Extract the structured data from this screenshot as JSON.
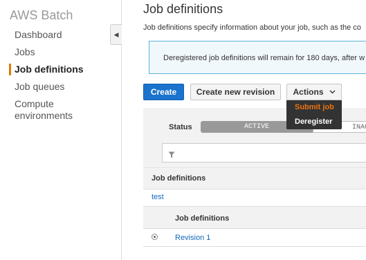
{
  "sidebar": {
    "brand": "AWS Batch",
    "items": [
      {
        "label": "Dashboard"
      },
      {
        "label": "Jobs"
      },
      {
        "label": "Job definitions"
      },
      {
        "label": "Job queues"
      },
      {
        "label": "Compute\nenvironments"
      }
    ],
    "collapse_icon": "caret-left-icon"
  },
  "main": {
    "title": "Job definitions",
    "description": "Job definitions specify information about your job, such as the co",
    "info": "Deregistered job definitions will remain for 180 days, after w",
    "buttons": {
      "create": "Create",
      "create_revision": "Create new revision",
      "actions": "Actions"
    },
    "actions_menu": [
      {
        "label": "Submit job"
      },
      {
        "label": "Deregister"
      }
    ],
    "status": {
      "label": "Status",
      "active": "ACTIVE",
      "inactive": "INAC"
    },
    "table": {
      "header": "Job definitions",
      "rows": [
        {
          "name": "test"
        }
      ],
      "sub_header": "Job definitions",
      "revisions": [
        {
          "label": "Revision 1"
        }
      ]
    }
  },
  "colors": {
    "primary": "#1a73cc",
    "accent": "#ec7211",
    "link": "#1166bb"
  }
}
